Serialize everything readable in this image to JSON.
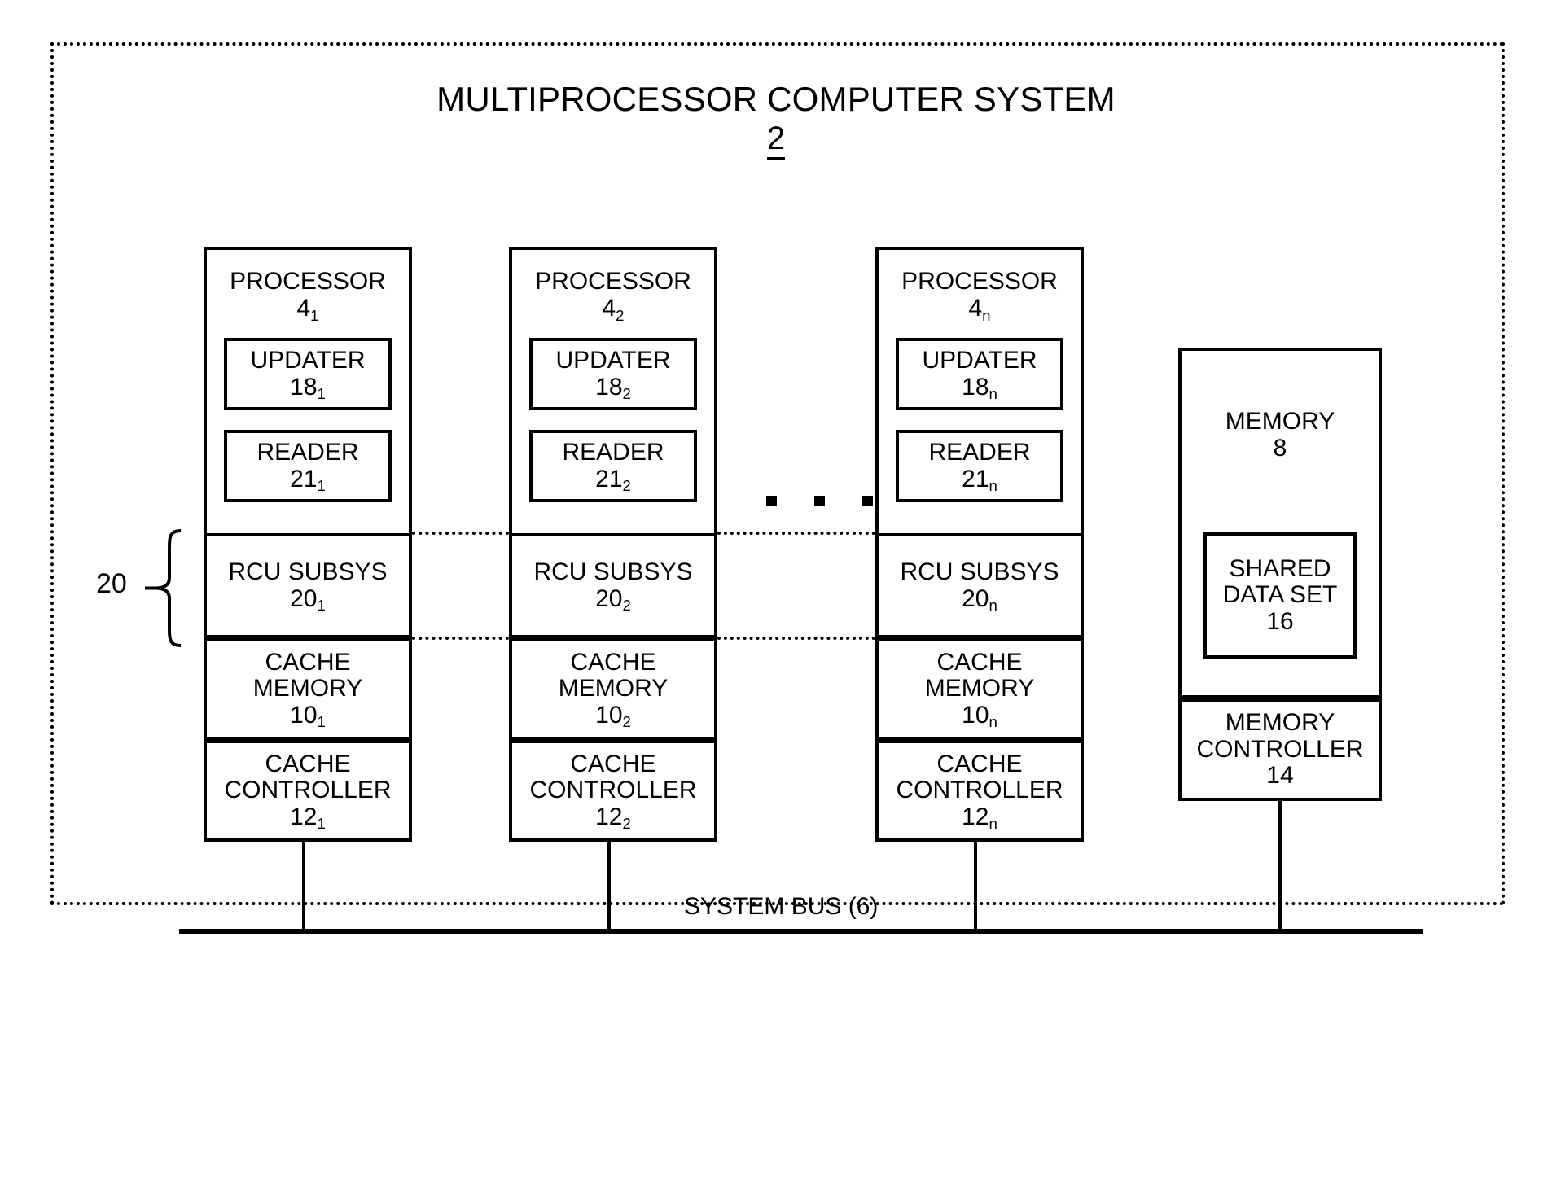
{
  "figure": {
    "title": "MULTIPROCESSOR COMPUTER SYSTEM",
    "number": "2"
  },
  "processors": [
    {
      "name": "PROCESSOR",
      "ref": "4",
      "sub": "1",
      "updater": {
        "name": "UPDATER",
        "ref": "18",
        "sub": "1"
      },
      "reader": {
        "name": "READER",
        "ref": "21",
        "sub": "1"
      },
      "rcu": {
        "name": "RCU SUBSYS",
        "ref": "20",
        "sub": "1"
      },
      "cache_memory": {
        "line1": "CACHE",
        "line2": "MEMORY",
        "ref": "10",
        "sub": "1"
      },
      "cache_controller": {
        "line1": "CACHE",
        "line2": "CONTROLLER",
        "ref": "12",
        "sub": "1"
      }
    },
    {
      "name": "PROCESSOR",
      "ref": "4",
      "sub": "2",
      "updater": {
        "name": "UPDATER",
        "ref": "18",
        "sub": "2"
      },
      "reader": {
        "name": "READER",
        "ref": "21",
        "sub": "2"
      },
      "rcu": {
        "name": "RCU SUBSYS",
        "ref": "20",
        "sub": "2"
      },
      "cache_memory": {
        "line1": "CACHE",
        "line2": "MEMORY",
        "ref": "10",
        "sub": "2"
      },
      "cache_controller": {
        "line1": "CACHE",
        "line2": "CONTROLLER",
        "ref": "12",
        "sub": "2"
      }
    },
    {
      "name": "PROCESSOR",
      "ref": "4",
      "sub": "n",
      "updater": {
        "name": "UPDATER",
        "ref": "18",
        "sub": "n"
      },
      "reader": {
        "name": "READER",
        "ref": "21",
        "sub": "n"
      },
      "rcu": {
        "name": "RCU SUBSYS",
        "ref": "20",
        "sub": "n"
      },
      "cache_memory": {
        "line1": "CACHE",
        "line2": "MEMORY",
        "ref": "10",
        "sub": "n"
      },
      "cache_controller": {
        "line1": "CACHE",
        "line2": "CONTROLLER",
        "ref": "12",
        "sub": "n"
      }
    }
  ],
  "memory": {
    "name": "MEMORY",
    "ref": "8",
    "shared_data_set": {
      "line1": "SHARED",
      "line2": "DATA SET",
      "ref": "16"
    },
    "controller": {
      "line1": "MEMORY",
      "line2": "CONTROLLER",
      "ref": "14"
    }
  },
  "rcu_group": {
    "label": "20"
  },
  "bus": {
    "label": "SYSTEM BUS (6)"
  },
  "ellipsis": "▪ ▪ ▪",
  "colors": {
    "line": "#000000",
    "background": "#ffffff"
  }
}
